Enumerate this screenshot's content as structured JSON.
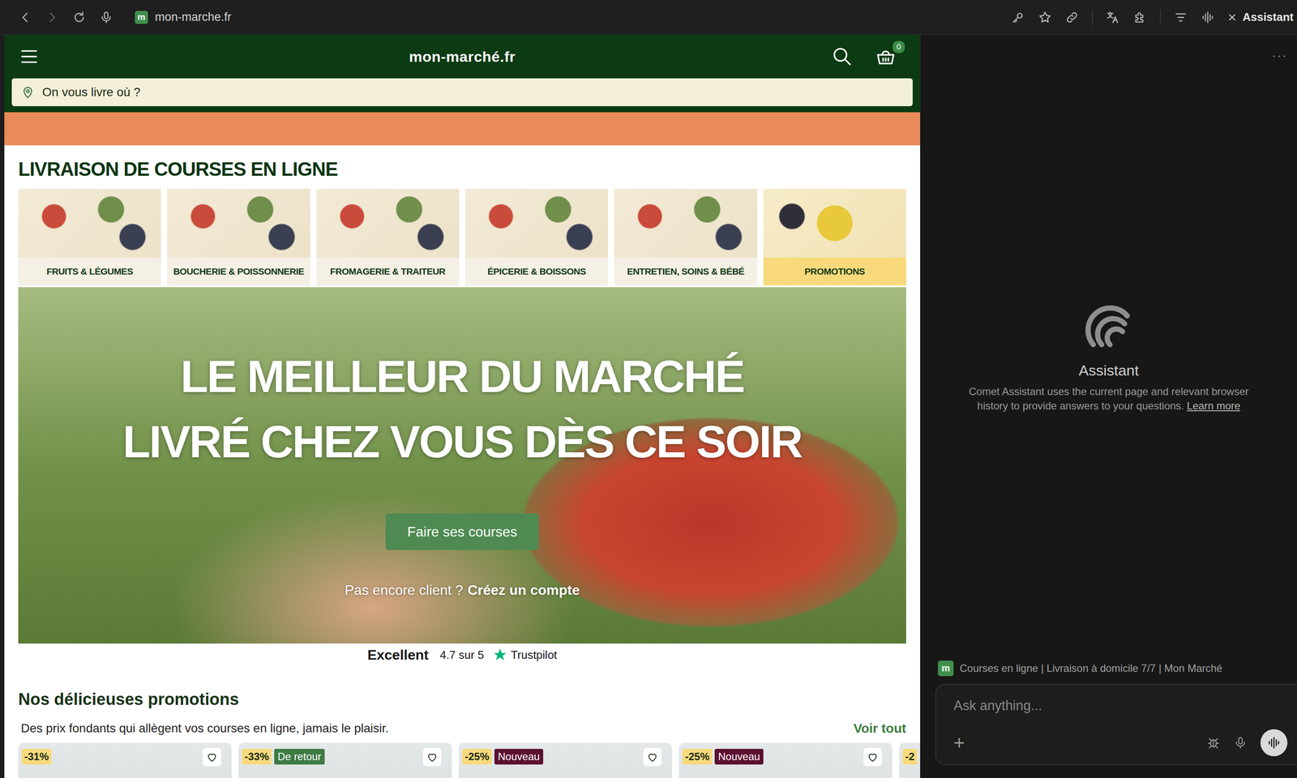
{
  "browser": {
    "favicon": "m",
    "url": "mon-marche.fr",
    "close": "×",
    "panel_toggle": "Assistant"
  },
  "site": {
    "logo": "mon-marché.fr",
    "cart_count": "0",
    "location_placeholder": "On vous livre où ?"
  },
  "section_title": "LIVRAISON DE COURSES EN LIGNE",
  "categories": [
    {
      "label": "FRUITS & LÉGUMES",
      "kind": "normal"
    },
    {
      "label": "BOUCHERIE & POISSONNERIE",
      "kind": "normal"
    },
    {
      "label": "FROMAGERIE & TRAITEUR",
      "kind": "normal"
    },
    {
      "label": "ÉPICERIE & BOISSONS",
      "kind": "normal"
    },
    {
      "label": "ENTRETIEN, SOINS & BÉBÉ",
      "kind": "normal"
    },
    {
      "label": "PROMOTIONS",
      "kind": "promo"
    }
  ],
  "hero": {
    "line1": "LE MEILLEUR DU MARCHÉ",
    "line2": "LIVRÉ CHEZ VOUS DÈS CE SOIR",
    "button": "Faire ses courses",
    "signup_prompt": "Pas encore client ?",
    "signup_link": "Créez un compte"
  },
  "rating": {
    "label": "Excellent",
    "score": "4.7 sur 5",
    "brand": "Trustpilot"
  },
  "promotions": {
    "title": "Nos délicieuses promotions",
    "subtitle": "Des prix fondants qui allègent vos courses en ligne, jamais le plaisir.",
    "see_all": "Voir tout",
    "cards": [
      {
        "discount": "-31%",
        "favorite": false
      },
      {
        "discount": "-33%",
        "tag": {
          "text": "De retour",
          "color": "#3e7b43"
        },
        "favorite": false
      },
      {
        "discount": "-25%",
        "tag": {
          "text": "Nouveau",
          "color": "#5b1030"
        },
        "favorite": false
      },
      {
        "discount": "-25%",
        "tag": {
          "text": "Nouveau",
          "color": "#5b1030"
        },
        "favorite": false
      },
      {
        "discount": "-2",
        "favorite": false
      }
    ]
  },
  "assistant": {
    "more": "···",
    "title": "Assistant",
    "description": "Comet Assistant uses the current page and relevant browser history to provide answers to your questions.",
    "learn_more": "Learn more",
    "context": {
      "favicon": "m",
      "title": "Courses en ligne | Livraison à domicile 7/7 | Mon Marché"
    },
    "placeholder": "Ask anything...",
    "add": "+"
  }
}
